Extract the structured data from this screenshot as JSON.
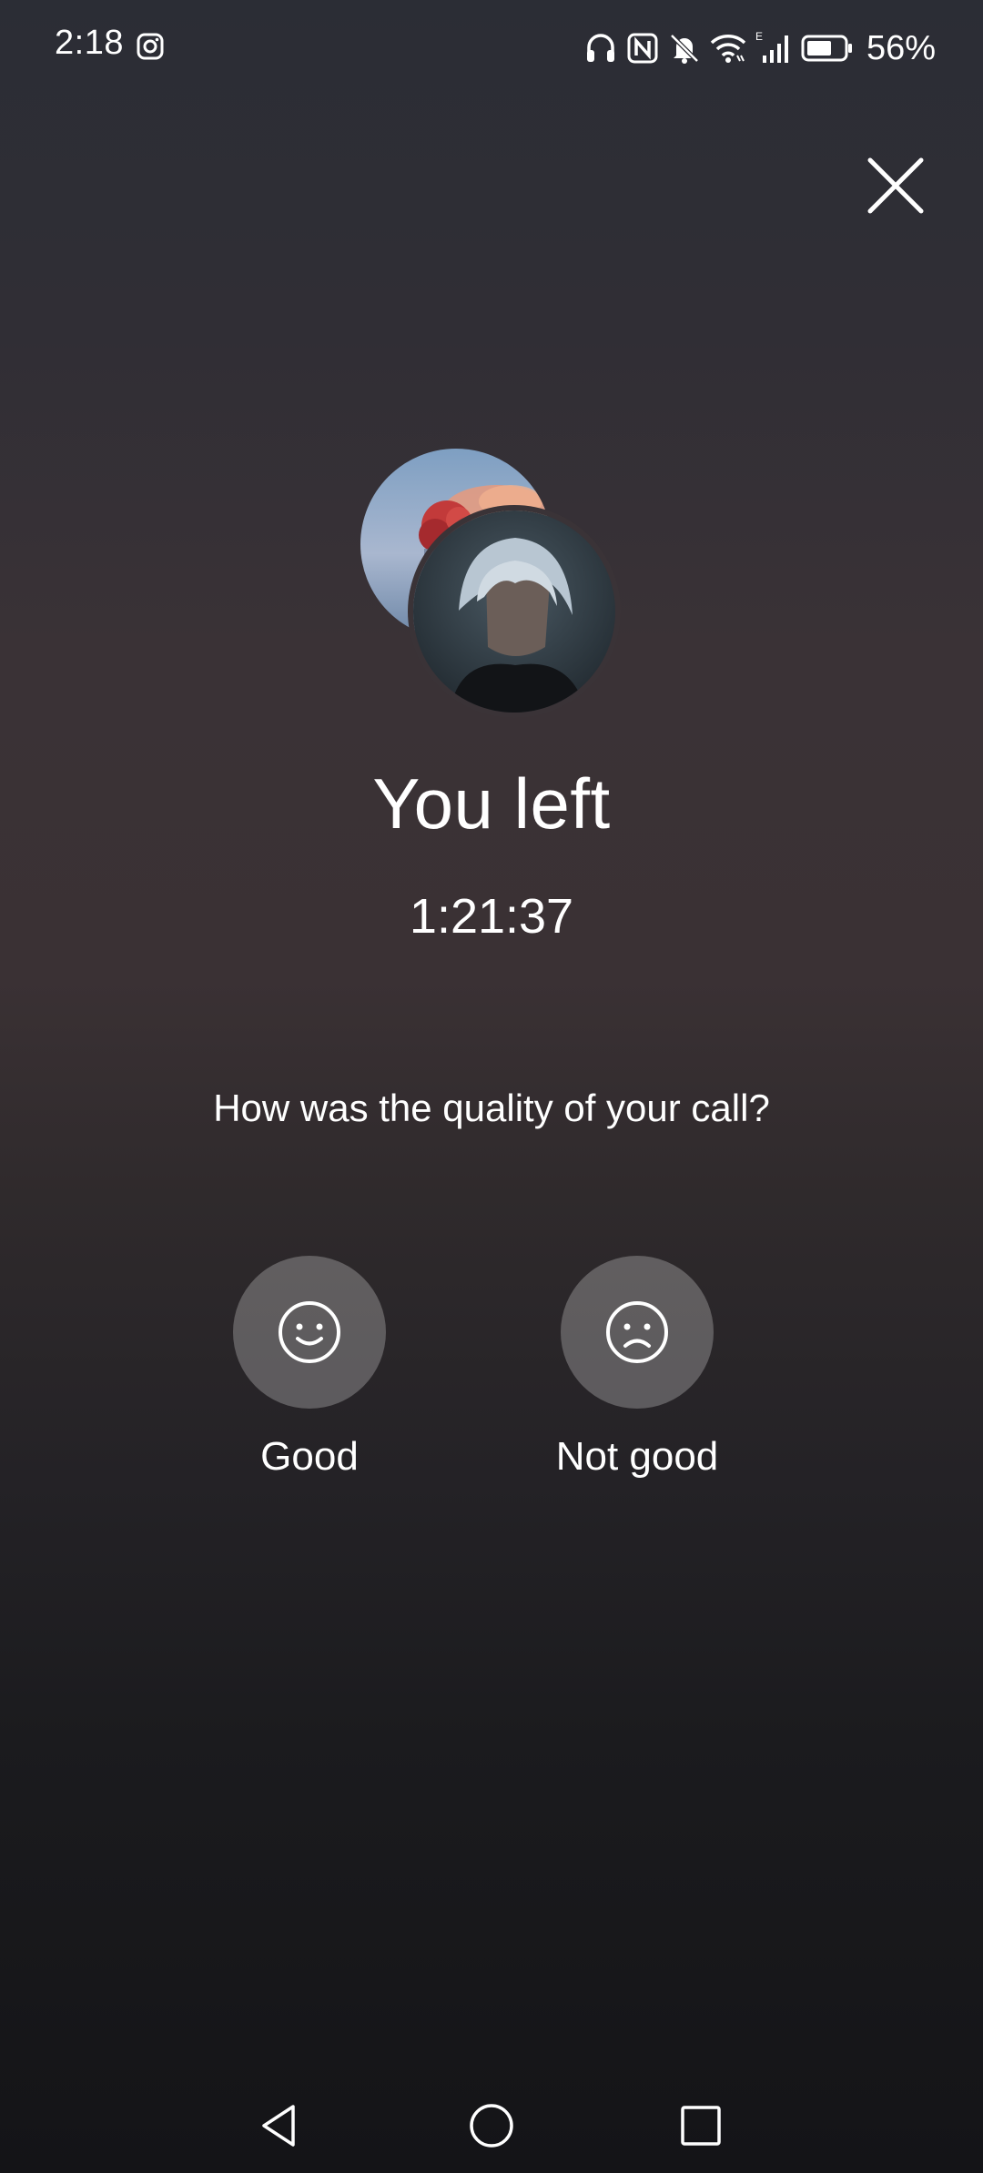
{
  "status_bar": {
    "time": "2:18",
    "battery": "56%",
    "icons": [
      "instagram-icon",
      "headphones-icon",
      "nfc-icon",
      "bell-off-icon",
      "wifi-icon",
      "signal-icon",
      "battery-icon"
    ]
  },
  "call_end": {
    "title": "You left",
    "duration": "1:21:37",
    "question": "How was the quality of your call?",
    "good_label": "Good",
    "not_good_label": "Not good"
  },
  "colors": {
    "background_top": "#2b2d35",
    "background_mid": "#3a3236",
    "background_bottom": "#141417",
    "rating_button": "rgba(255,255,255,0.25)"
  },
  "nav_bar": {
    "icons": [
      "back-icon",
      "home-icon",
      "recents-icon"
    ]
  }
}
